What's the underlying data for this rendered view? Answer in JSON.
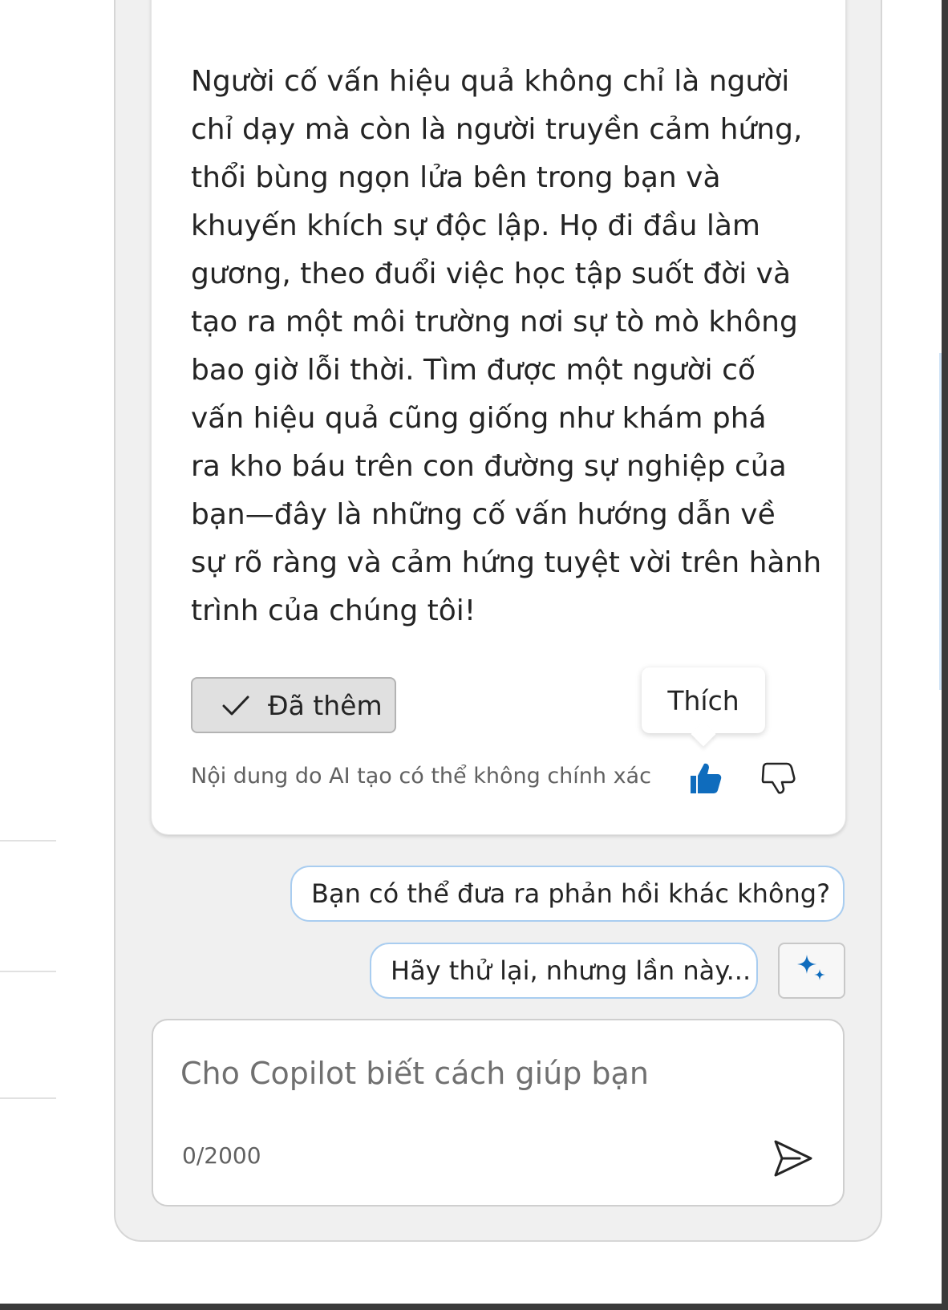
{
  "message": {
    "lines": [
      "Người cố vấn hiệu quả không chỉ là người",
      "chỉ dạy mà còn là người truyền cảm hứng,",
      "thổi bùng ngọn lửa bên trong bạn và",
      "khuyến khích sự độc lập. Họ đi đầu làm",
      "gương, theo đuổi việc học tập suốt đời và",
      "tạo ra một môi trường nơi sự tò mò không",
      "bao giờ lỗi thời. Tìm được một người cố",
      "vấn hiệu quả cũng giống như khám phá",
      "ra kho báu trên con đường sự nghiệp của",
      "bạn—đây là những cố vấn hướng dẫn về",
      "sự rõ ràng và cảm hứng tuyệt vời trên hành",
      "trình của chúng tôi!"
    ]
  },
  "actions": {
    "added_label": "Đã thêm",
    "tooltip_like": "Thích",
    "disclaimer": "Nội dung do AI tạo có thể không chính xác"
  },
  "suggestions": {
    "items": [
      "Bạn có thể đưa ra phản hồi khác không?",
      "Hãy thử lại, nhưng lần này..."
    ]
  },
  "composer": {
    "placeholder": "Cho Copilot biết cách giúp bạn",
    "value": "",
    "char_count": "0/2000"
  },
  "icons": {
    "check": "check-icon",
    "like": "thumbs-up-icon",
    "dislike": "thumbs-down-icon",
    "sparkle": "sparkle-icon",
    "send": "send-icon"
  },
  "colors": {
    "accent": "#0f6cbd",
    "suggestion_border": "#a9cdf0",
    "panel_bg": "#f0f0f0"
  }
}
